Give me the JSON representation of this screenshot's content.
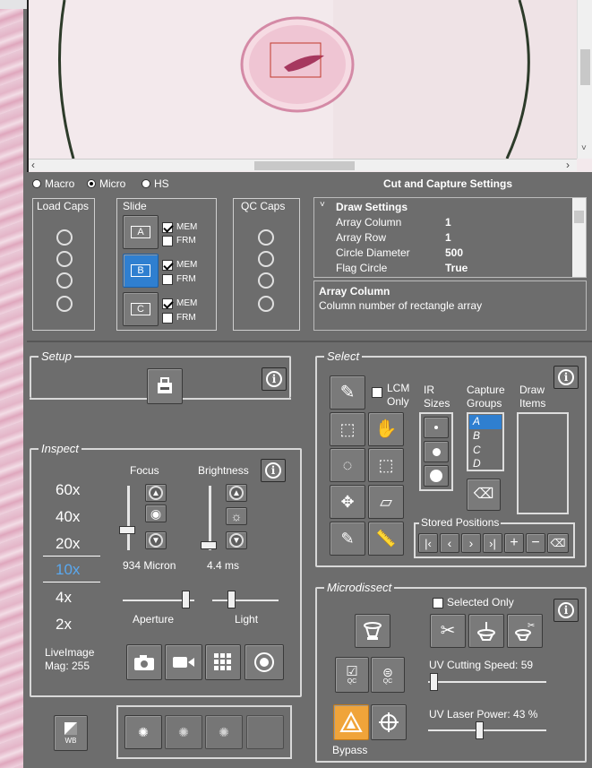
{
  "view_modes": {
    "macro": "Macro",
    "micro": "Micro",
    "hs": "HS",
    "selected": "Micro"
  },
  "settings_title": "Cut and Capture Settings",
  "load_caps": {
    "title": "Load Caps"
  },
  "slide": {
    "title": "Slide",
    "slots": [
      {
        "label": "A",
        "mem": "MEM",
        "frm": "FRM",
        "mem_checked": true,
        "frm_checked": false,
        "active": false
      },
      {
        "label": "B",
        "mem": "MEM",
        "frm": "FRM",
        "mem_checked": true,
        "frm_checked": false,
        "active": true
      },
      {
        "label": "C",
        "mem": "MEM",
        "frm": "FRM",
        "mem_checked": true,
        "frm_checked": false,
        "active": false
      }
    ]
  },
  "qc_caps": {
    "title": "QC Caps"
  },
  "draw_settings": {
    "header": "Draw Settings",
    "rows": [
      {
        "name": "Array Column",
        "value": "1"
      },
      {
        "name": "Array Row",
        "value": "1"
      },
      {
        "name": "Circle Diameter",
        "value": "500"
      },
      {
        "name": "Flag Circle",
        "value": "True"
      }
    ],
    "desc_title": "Array Column",
    "desc_text": "Column number of rectangle array"
  },
  "setup": {
    "title": "Setup"
  },
  "inspect": {
    "title": "Inspect",
    "magnifications": [
      "60x",
      "40x",
      "20x",
      "10x",
      "4x",
      "2x"
    ],
    "selected_mag": "10x",
    "focus_label": "Focus",
    "brightness_label": "Brightness",
    "focus_value": "934 Micron",
    "brightness_value": "4.4 ms",
    "aperture_label": "Aperture",
    "light_label": "Light",
    "liveimage_line1": "LiveImage",
    "liveimage_line2": "Mag: 255"
  },
  "wb_label": "WB",
  "select": {
    "title": "Select",
    "lcm_only_line1": "LCM",
    "lcm_only_line2": "Only",
    "ir_sizes_line1": "IR",
    "ir_sizes_line2": "Sizes",
    "capture_groups_line1": "Capture",
    "capture_groups_line2": "Groups",
    "draw_items_line1": "Draw",
    "draw_items_line2": "Items",
    "groups": [
      "A",
      "B",
      "C",
      "D"
    ],
    "selected_group": "A",
    "stored_positions": "Stored Positions"
  },
  "microdissect": {
    "title": "Microdissect",
    "selected_only": "Selected Only",
    "uv_cutting_speed": "UV Cutting Speed: 59",
    "uv_laser_power": "UV Laser Power: 43 %",
    "bypass": "Bypass",
    "cutting_speed_level": 0.05,
    "laser_power_level": 0.43
  },
  "colors": {
    "accent_blue": "#2f7fd0",
    "bypass_orange": "#f0a43a",
    "panel_bg": "#6d6d6d"
  }
}
